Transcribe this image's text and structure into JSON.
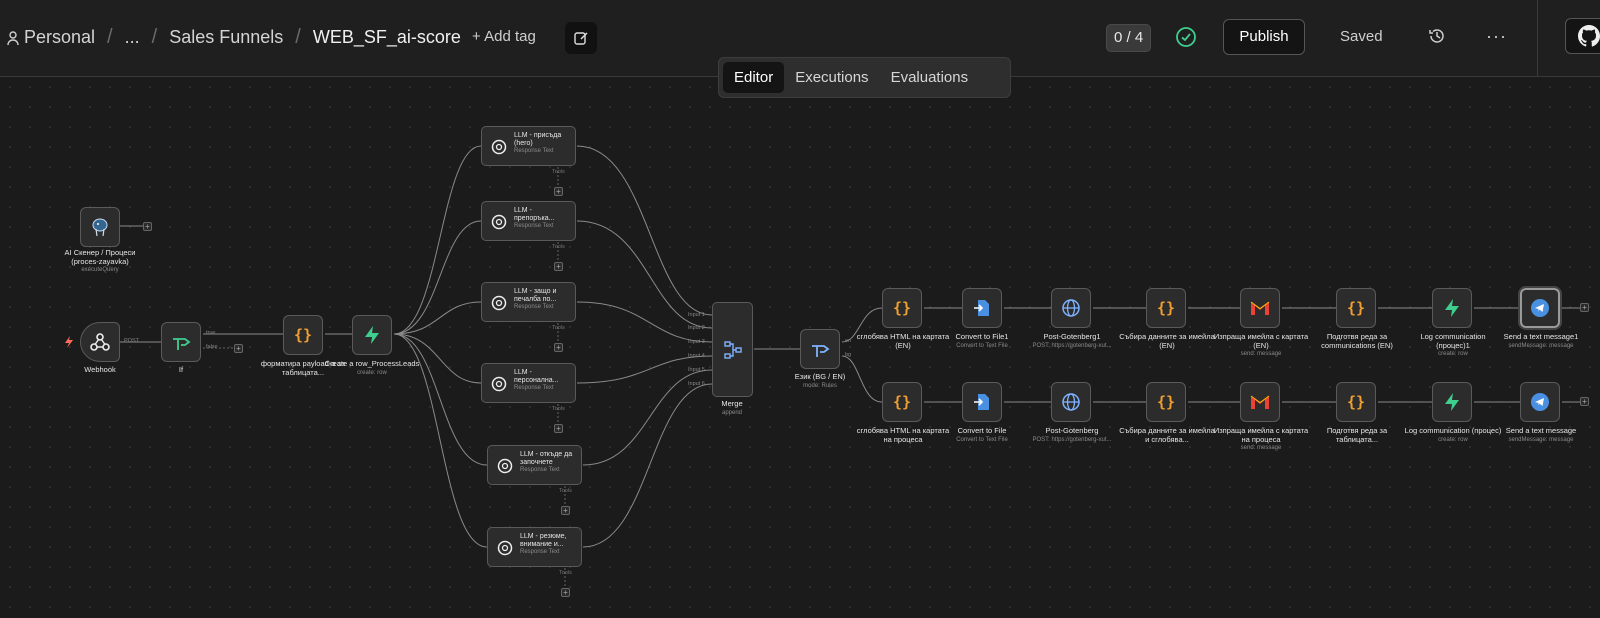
{
  "header": {
    "breadcrumb": {
      "personal": "Personal",
      "ellipsis": "...",
      "folder": "Sales Funnels",
      "workflow": "WEB_SF_ai-score"
    },
    "add_tag": "+ Add tag",
    "counter": "0 / 4",
    "publish": "Publish",
    "saved": "Saved",
    "more": "···"
  },
  "tabs": {
    "editor": "Editor",
    "executions": "Executions",
    "evaluations": "Evaluations"
  },
  "nodes": {
    "ai_scanner": {
      "label": "AI Скенер / Процеси (proces-zayavka)",
      "sub": "executeQuery"
    },
    "webhook": {
      "label": "Webhook",
      "port": "POST"
    },
    "if": {
      "label": "If",
      "true": "true",
      "false": "false"
    },
    "format_payload": {
      "label": "форматира payload-а за таблицата..."
    },
    "create_row": {
      "label": "Create a row_ProcessLeads",
      "sub": "create: row"
    },
    "llm1": {
      "label": "LLM - присъда (hero)",
      "sub": "Response Text"
    },
    "llm2": {
      "label": "LLM - препоръка...",
      "sub": "Response Text"
    },
    "llm3": {
      "label": "LLM - защо и печалба по...",
      "sub": "Response Text"
    },
    "llm4": {
      "label": "LLM - персонална...",
      "sub": "Response Text"
    },
    "llm5": {
      "label": "LLM - откъде да започнете",
      "sub": "Response Text"
    },
    "llm6": {
      "label": "LLM - резюме, внимание и...",
      "sub": "Response Text"
    },
    "tools_label": "Tools",
    "merge": {
      "label": "Merge",
      "sub": "append",
      "inputs": [
        "Input 1",
        "Input 2",
        "Input 3",
        "Input 4",
        "Input 5",
        "Input 6"
      ]
    },
    "language": {
      "label": "Език (BG / EN)",
      "sub": "mode: Rules",
      "out1": "en",
      "out2": "bg"
    },
    "top_row": [
      {
        "label": "сглобява HTML на картата (EN)",
        "sub": ""
      },
      {
        "label": "Convert to File1",
        "sub": "Convert to Text File"
      },
      {
        "label": "Post-Gotenberg1",
        "sub": "POST: https://gotenberg-xut..."
      },
      {
        "label": "Събира данните за имейла (EN)",
        "sub": ""
      },
      {
        "label": "Изпраща имейла с картата (EN)",
        "sub": "send: message"
      },
      {
        "label": "Подготвя реда за communications (EN)",
        "sub": ""
      },
      {
        "label": "Log communication (процес)1",
        "sub": "create: row"
      },
      {
        "label": "Send a text message1",
        "sub": "sendMessage: message"
      }
    ],
    "bottom_row": [
      {
        "label": "сглобява HTML на картата на процеса",
        "sub": ""
      },
      {
        "label": "Convert to File",
        "sub": "Convert to Text File"
      },
      {
        "label": "Post-Gotenberg",
        "sub": "POST: https://gotenberg-xut..."
      },
      {
        "label": "Събира данните за имейла и сглобява...",
        "sub": ""
      },
      {
        "label": "Изпраща имейла с картата на процеса",
        "sub": "send: message"
      },
      {
        "label": "Подготвя реда за таблицата...",
        "sub": ""
      },
      {
        "label": "Log communication (процес)",
        "sub": "create: row"
      },
      {
        "label": "Send a text message",
        "sub": "sendMessage: message"
      }
    ]
  },
  "colors": {
    "accent_green": "#3ecf8e",
    "brace_orange": "#f0a030",
    "telegram_blue": "#4a90e2"
  }
}
